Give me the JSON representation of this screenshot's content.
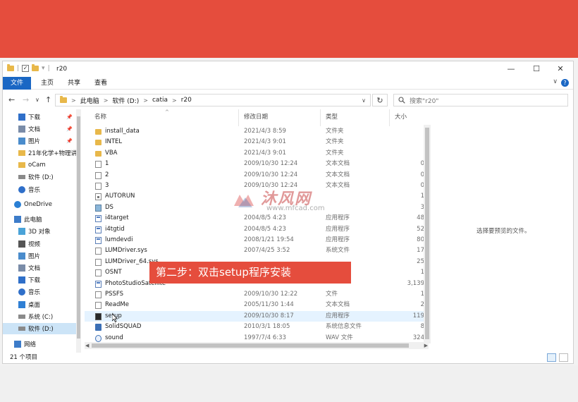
{
  "window": {
    "title": "r20",
    "controls": {
      "minimize": "—",
      "maximize": "☐",
      "close": "✕"
    }
  },
  "quick_access": {
    "separator": "|",
    "dropdown": "▾"
  },
  "ribbon": {
    "tabs": [
      "文件",
      "主页",
      "共享",
      "查看"
    ],
    "expand_icon": "chevron-down-icon",
    "help_icon": "help-icon",
    "help_glyph": "?"
  },
  "nav": {
    "back": "←",
    "forward": "→",
    "recent": "∨",
    "up": "↑",
    "breadcrumb": [
      "此电脑",
      "软件 (D:)",
      "catia",
      "r20"
    ],
    "breadcrumb_sep": ">",
    "dropdown": "∨",
    "refresh": "↻",
    "search_placeholder": "搜索\"r20\""
  },
  "sidebar": [
    {
      "label": "下载",
      "icon": "download-icon",
      "pinned": true
    },
    {
      "label": "文档",
      "icon": "document-icon",
      "pinned": true
    },
    {
      "label": "图片",
      "icon": "picture-icon",
      "pinned": true
    },
    {
      "label": "21年化学+物理讲",
      "icon": "folder-icon",
      "pinned": false
    },
    {
      "label": "oCam",
      "icon": "folder-icon",
      "pinned": false
    },
    {
      "label": "软件 (D:)",
      "icon": "drive-icon",
      "pinned": false
    },
    {
      "label": "音乐",
      "icon": "music-icon",
      "pinned": false
    },
    {
      "label": "OneDrive",
      "icon": "cloud-icon",
      "pinned": false
    },
    {
      "label": "此电脑",
      "icon": "computer-icon",
      "pinned": false
    },
    {
      "label": "3D 对象",
      "icon": "cube-icon",
      "pinned": false
    },
    {
      "label": "视频",
      "icon": "video-icon",
      "pinned": false
    },
    {
      "label": "图片",
      "icon": "picture-icon",
      "pinned": false
    },
    {
      "label": "文档",
      "icon": "document-icon",
      "pinned": false
    },
    {
      "label": "下载",
      "icon": "download-icon",
      "pinned": false
    },
    {
      "label": "音乐",
      "icon": "music-icon",
      "pinned": false
    },
    {
      "label": "桌面",
      "icon": "desktop-icon",
      "pinned": false
    },
    {
      "label": "系统 (C:)",
      "icon": "drive-icon",
      "pinned": false
    },
    {
      "label": "软件 (D:)",
      "icon": "drive-icon",
      "pinned": false,
      "selected": true
    },
    {
      "label": "网络",
      "icon": "network-icon",
      "pinned": false
    }
  ],
  "pin_glyph": "📌",
  "columns": {
    "name": "名称",
    "date": "修改日期",
    "type": "类型",
    "size": "大小",
    "sort_glyph": "^"
  },
  "files": [
    {
      "name": "install_data",
      "date": "2021/4/3 8:59",
      "type": "文件夹",
      "size": "",
      "icon": "folder"
    },
    {
      "name": "INTEL",
      "date": "2021/4/3 9:01",
      "type": "文件夹",
      "size": "",
      "icon": "folder"
    },
    {
      "name": "VBA",
      "date": "2021/4/3 9:01",
      "type": "文件夹",
      "size": "",
      "icon": "folder"
    },
    {
      "name": "1",
      "date": "2009/10/30 12:24",
      "type": "文本文档",
      "size": "0",
      "icon": "text"
    },
    {
      "name": "2",
      "date": "2009/10/30 12:24",
      "type": "文本文档",
      "size": "0",
      "icon": "text"
    },
    {
      "name": "3",
      "date": "2009/10/30 12:24",
      "type": "文本文档",
      "size": "0",
      "icon": "text"
    },
    {
      "name": "AUTORUN",
      "date": "",
      "type": "",
      "size": "1",
      "icon": "ini"
    },
    {
      "name": "DS",
      "date": "",
      "type": "",
      "size": "3",
      "icon": "bmp"
    },
    {
      "name": "i4target",
      "date": "2004/8/5 4:23",
      "type": "应用程序",
      "size": "48",
      "icon": "app"
    },
    {
      "name": "i4tgtid",
      "date": "2004/8/5 4:23",
      "type": "应用程序",
      "size": "52",
      "icon": "app"
    },
    {
      "name": "lumdevdi",
      "date": "2008/1/21 19:54",
      "type": "应用程序",
      "size": "80",
      "icon": "app"
    },
    {
      "name": "LUMDriver.sys",
      "date": "2007/4/25 3:52",
      "type": "系统文件",
      "size": "17",
      "icon": "text"
    },
    {
      "name": "LUMDriver_64.sys",
      "date": "",
      "type": "",
      "size": "25",
      "icon": "text"
    },
    {
      "name": "OSNT",
      "date": "",
      "type": "",
      "size": "1",
      "icon": "text"
    },
    {
      "name": "PhotoStudioSatellite",
      "date": "",
      "type": "",
      "size": "3,139",
      "icon": "app"
    },
    {
      "name": "PSSFS",
      "date": "2009/10/30 12:22",
      "type": "文件",
      "size": "1",
      "icon": "text"
    },
    {
      "name": "ReadMe",
      "date": "2005/11/30 1:44",
      "type": "文本文档",
      "size": "2",
      "icon": "text"
    },
    {
      "name": "setup",
      "date": "2009/10/30 8:17",
      "type": "应用程序",
      "size": "119",
      "icon": "setup",
      "hover": true
    },
    {
      "name": "SolidSQUAD",
      "date": "2010/3/1 18:05",
      "type": "系统信息文件",
      "size": "8",
      "icon": "reg"
    },
    {
      "name": "sound",
      "date": "1997/7/4 6:33",
      "type": "WAV 文件",
      "size": "324",
      "icon": "wav"
    }
  ],
  "preview": {
    "empty_text": "选择要预览的文件。"
  },
  "status": {
    "item_count": "21 个项目"
  },
  "caption": "第二步：双击setup程序安装",
  "watermark": {
    "main": "沐风网",
    "sub": "www.mfcad.com"
  },
  "colors": {
    "banner": "#e54d3d",
    "accent": "#1a67c4",
    "selection": "#cce4f7",
    "hover": "#e5f3ff"
  }
}
